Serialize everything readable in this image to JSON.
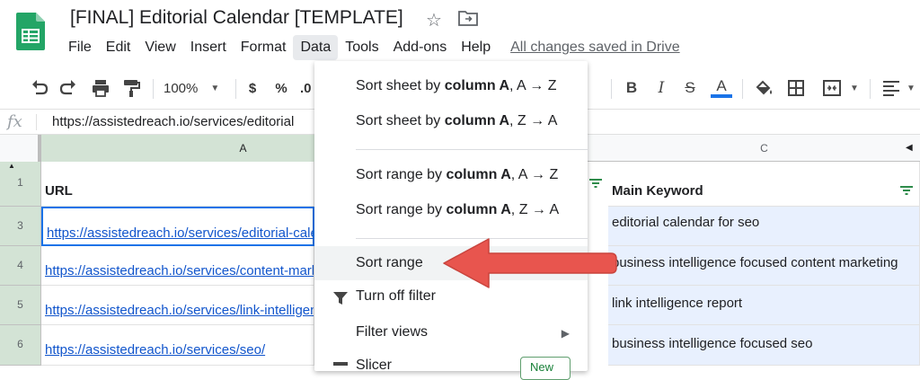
{
  "header": {
    "doc_title": "[FINAL] Editorial Calendar [TEMPLATE]",
    "menus": [
      "File",
      "Edit",
      "View",
      "Insert",
      "Format",
      "Data",
      "Tools",
      "Add-ons",
      "Help"
    ],
    "active_menu": "Data",
    "save_status": "All changes saved in Drive"
  },
  "toolbar": {
    "zoom": "100%",
    "currency_label": "$",
    "percent_label": "%",
    "decimal_label": ".0"
  },
  "formula_bar": {
    "fx_label": "fx",
    "value": "https://assistedreach.io/services/editorial"
  },
  "grid": {
    "columns": [
      "A",
      "C"
    ],
    "row_numbers": [
      "1",
      "3",
      "4",
      "5",
      "6"
    ],
    "header_row": {
      "col_a": "URL",
      "col_c": "Main Keyword"
    },
    "rows": [
      {
        "url": "https://assistedreach.io/services/editorial-calendar/",
        "keyword": "editorial calendar for seo"
      },
      {
        "url": "https://assistedreach.io/services/content-marketing/",
        "keyword": "business intelligence focused content marketing"
      },
      {
        "url": "https://assistedreach.io/services/link-intelligence/",
        "keyword": "link intelligence report"
      },
      {
        "url": "https://assistedreach.io/services/seo/",
        "keyword": "business intelligence focused seo"
      }
    ]
  },
  "data_menu": {
    "sort_sheet_az": {
      "prefix": "Sort sheet by ",
      "bold": "column A",
      "suffix": ", A → Z"
    },
    "sort_sheet_za": {
      "prefix": "Sort sheet by ",
      "bold": "column A",
      "suffix": ", Z → A"
    },
    "sort_range_az": {
      "prefix": "Sort range by ",
      "bold": "column A",
      "suffix": ", A → Z"
    },
    "sort_range_za": {
      "prefix": "Sort range by ",
      "bold": "column A",
      "suffix": ", Z → A"
    },
    "sort_range": "Sort range",
    "turn_off_filter": "Turn off filter",
    "filter_views": "Filter views",
    "slicer": "Slicer",
    "slicer_badge": "New"
  },
  "colors": {
    "accent_green": "#188038",
    "annotation_red": "#e8554e",
    "link_blue": "#1155cc"
  }
}
